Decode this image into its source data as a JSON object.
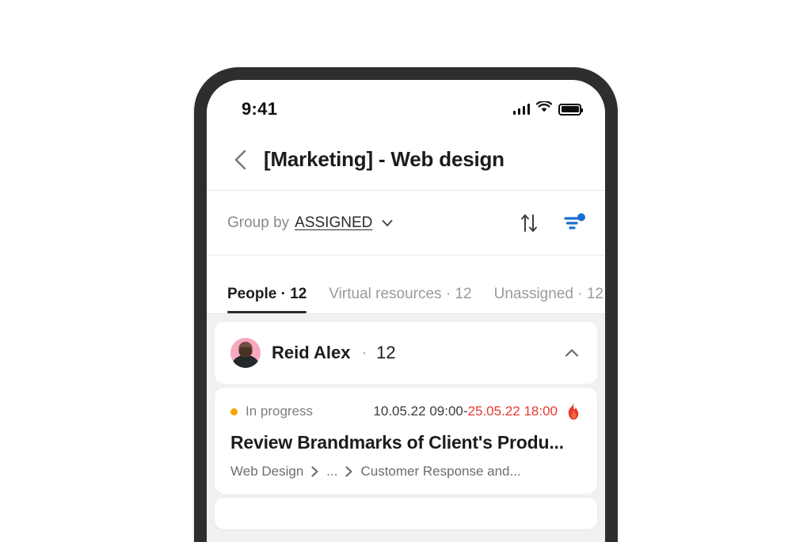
{
  "status_bar": {
    "time": "9:41",
    "signal_icon": "cellular-signal-icon",
    "wifi_icon": "wifi-icon",
    "battery_icon": "battery-full-icon"
  },
  "nav": {
    "back_icon": "chevron-left-icon",
    "title": "[Marketing] - Web design"
  },
  "groupby": {
    "label": "Group by",
    "value": "ASSIGNED",
    "chevron_icon": "chevron-down-icon",
    "sort_icon": "sort-arrows-icon",
    "filter_icon": "filter-icon",
    "filter_badge_color": "#1a6fd4",
    "filter_active": true
  },
  "tabs": [
    {
      "label": "People",
      "count": "12",
      "active": true
    },
    {
      "label": "Virtual resources",
      "count": "12",
      "active": false
    },
    {
      "label": "Unassigned",
      "count": "12",
      "active": false
    }
  ],
  "group": {
    "avatar_name": "user-avatar",
    "person_name": "Reid Alex",
    "separator": "·",
    "count": "12",
    "collapse_icon": "chevron-up-icon"
  },
  "task": {
    "status": "In progress",
    "status_color": "#f5a302",
    "date_start": "10.05.22 09:00",
    "date_dash": " - ",
    "date_end": "25.05.22 18:00",
    "date_end_color": "#e8392c",
    "urgency_icon": "fire-icon",
    "title": "Review Brandmarks of Client's Produ...",
    "breadcrumb": {
      "first": "Web Design",
      "middle": "...",
      "last": "Customer Response and...",
      "separator_icon": "chevron-right-icon"
    }
  }
}
